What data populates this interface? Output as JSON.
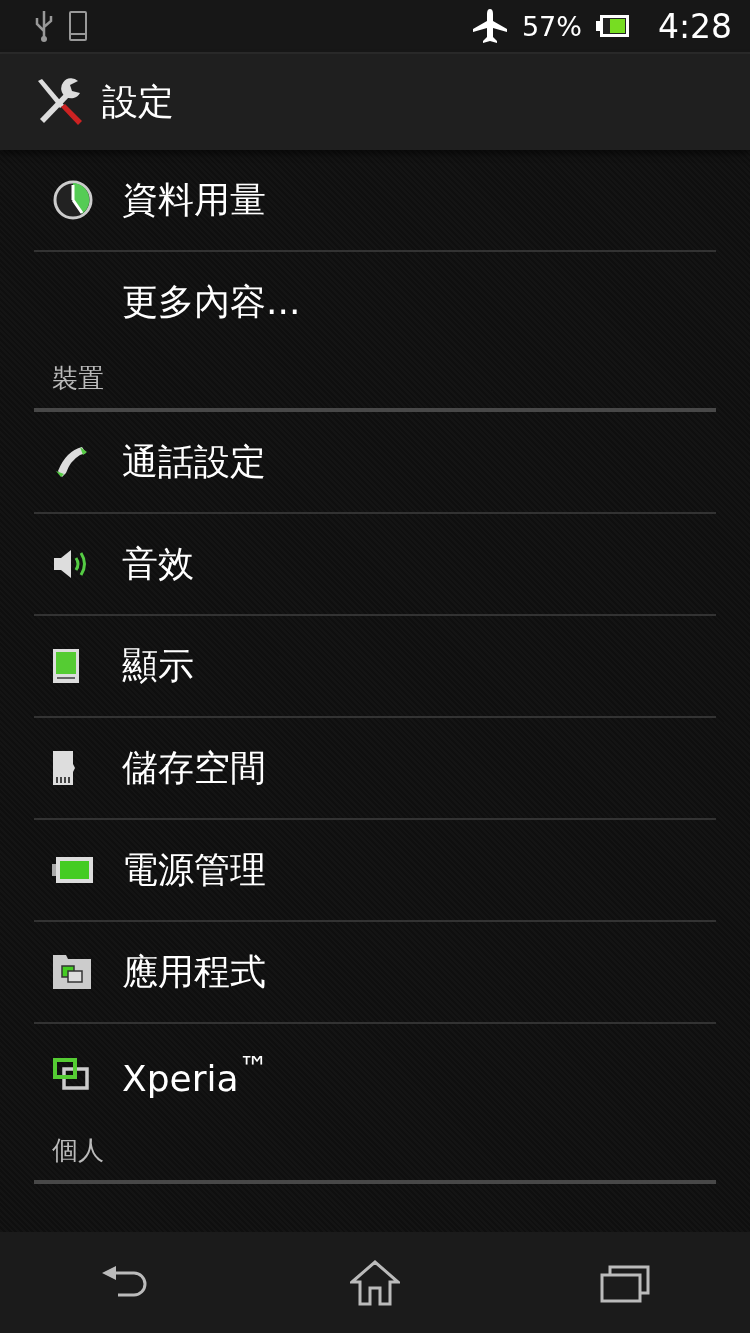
{
  "status_bar": {
    "battery": "57%",
    "time": "4:28"
  },
  "action_bar": {
    "title": "設定"
  },
  "sections": [
    {
      "items": [
        {
          "label": "資料用量",
          "kind": "data"
        },
        {
          "label": "更多內容...",
          "kind": "none"
        }
      ]
    },
    {
      "header": "裝置",
      "items": [
        {
          "label": "通話設定",
          "kind": "phone"
        },
        {
          "label": "音效",
          "kind": "sound"
        },
        {
          "label": "顯示",
          "kind": "display"
        },
        {
          "label": "儲存空間",
          "kind": "storage"
        },
        {
          "label": "電源管理",
          "kind": "power"
        },
        {
          "label": "應用程式",
          "kind": "apps"
        },
        {
          "label": "Xperia$^{™}$",
          "kind": "xperia"
        }
      ]
    },
    {
      "header": "個人"
    }
  ]
}
